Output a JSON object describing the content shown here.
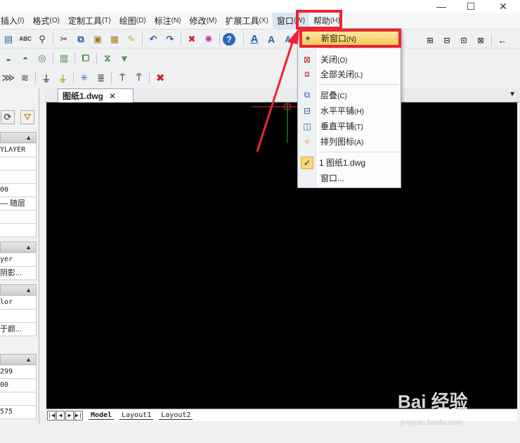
{
  "window": {
    "controls": {
      "minimize": "—",
      "maximize": "☐",
      "close": "✕"
    }
  },
  "menubar": {
    "items": [
      {
        "label": "插入",
        "mn": "(I)"
      },
      {
        "label": "格式",
        "mn": "(O)"
      },
      {
        "label": "定制工具",
        "mn": "(T)"
      },
      {
        "label": "绘图",
        "mn": "(D)"
      },
      {
        "label": "标注",
        "mn": "(N)"
      },
      {
        "label": "修改",
        "mn": "(M)"
      },
      {
        "label": "扩展工具",
        "mn": "(X)"
      },
      {
        "label": "窗口",
        "mn": "(W)"
      },
      {
        "label": "帮助",
        "mn": "(H)"
      }
    ]
  },
  "toolbar": {
    "text_a1": "A",
    "text_a2": "A",
    "text_a3": "A",
    "help": "?",
    "arrow_left": "←"
  },
  "properties": {
    "rows": [
      "YLAYER",
      "",
      "",
      "00",
      "— 随层",
      "",
      "",
      "yer",
      "阴影...",
      "lor",
      "",
      "于颜...",
      "299",
      "00",
      "",
      "575"
    ]
  },
  "document": {
    "tab_label": "图纸1.dwg",
    "close": "✕",
    "tab_menu": "▼"
  },
  "layout_tabs": [
    "Model",
    "Layout1",
    "Layout2"
  ],
  "window_menu": {
    "items": [
      {
        "label": "新窗口",
        "sc": "(N)",
        "icon": "new-window-icon"
      },
      {
        "label": "关闭",
        "sc": "(O)",
        "icon": "close-window-icon"
      },
      {
        "label": "全部关闭",
        "sc": "(L)",
        "icon": "close-all-icon"
      },
      {
        "label": "层叠",
        "sc": "(C)",
        "icon": "cascade-icon"
      },
      {
        "label": "水平平铺",
        "sc": "(H)",
        "icon": "tile-horizontal-icon"
      },
      {
        "label": "垂直平铺",
        "sc": "(T)",
        "icon": "tile-vertical-icon"
      },
      {
        "label": "排列图标",
        "sc": "(A)",
        "icon": "arrange-icons-icon"
      },
      {
        "label": "1 图纸1.dwg",
        "sc": "",
        "icon": "check-icon"
      },
      {
        "label": "窗口...",
        "sc": "",
        "icon": ""
      }
    ]
  },
  "watermark": {
    "logo": "Bai 经验",
    "url": "jingyan.baidu.com"
  },
  "colors": {
    "annotation_red": "#ee2233",
    "highlight": "#f9c85a",
    "canvas": "#000000"
  }
}
